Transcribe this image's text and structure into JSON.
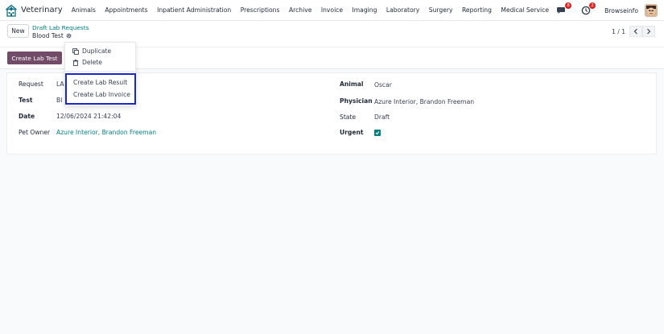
{
  "app": {
    "name": "Veterinary"
  },
  "menu": [
    "Animals",
    "Appointments",
    "Inpatient Administration",
    "Prescriptions",
    "Archive",
    "Invoice",
    "Imaging",
    "Laboratory",
    "Surgery",
    "Reporting",
    "Medical Service"
  ],
  "systray": {
    "messages_count": "8",
    "activity_count": "2",
    "company": "Browseinfo"
  },
  "control": {
    "new_label": "New",
    "breadcrumb_parent": "Draft Lab Requests",
    "breadcrumb_current": "Blood Test",
    "pager": "1 / 1"
  },
  "statusbar": {
    "create_button": "Create Lab Test"
  },
  "form": {
    "request_label": "Request",
    "request_value": "LA",
    "test_label": "Test",
    "test_value": "Bl",
    "date_label": "Date",
    "date_value": "12/06/2024 21:42:04",
    "owner_label": "Pet Owner",
    "owner_value": "Azure Interior, Brandon Freeman",
    "animal_label": "Animal",
    "animal_value": "Oscar",
    "physician_label": "Physician",
    "physician_value": "Azure Interior, Brandon Freeman",
    "state_label": "State",
    "state_value": "Draft",
    "urgent_label": "Urgent",
    "urgent_checked": true
  },
  "dropdown": {
    "duplicate": "Duplicate",
    "delete": "Delete",
    "create_result": "Create Lab Result",
    "create_invoice": "Create Lab Invoice"
  },
  "colors": {
    "primary": "#714b67",
    "link": "#017e84",
    "highlight": "#1d27c9"
  }
}
